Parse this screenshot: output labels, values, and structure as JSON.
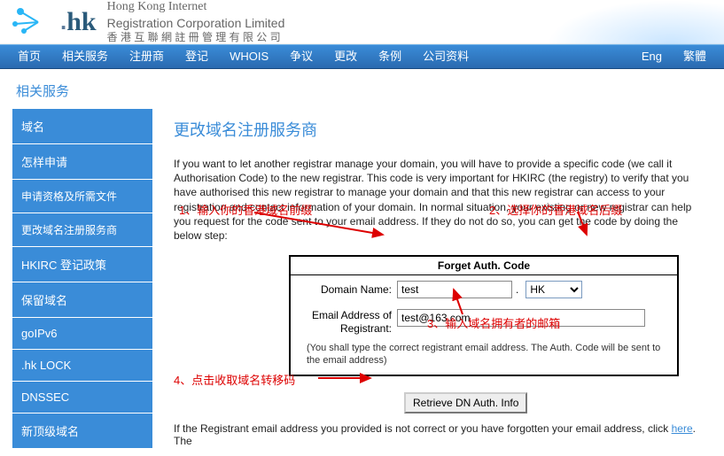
{
  "header": {
    "logo_dot": ".",
    "logo_hk": "hk",
    "en_name": "Hong Kong Internet",
    "en_name2": "Registration Corporation Limited",
    "cn_name": "香 港 互 聯 網 註 冊 管 理 有 限 公 司"
  },
  "topnav": {
    "items": [
      "首页",
      "相关服务",
      "注册商",
      "登记",
      "WHOIS",
      "争议",
      "更改",
      "条例",
      "公司资料"
    ],
    "lang": [
      "Eng",
      "繁體"
    ]
  },
  "section_title": "相关服务",
  "sidebar": {
    "items": [
      "域名",
      "怎样申请",
      "申请资格及所需文件",
      "更改域名注册服务商",
      "HKIRC 登记政策",
      "保留域名",
      "goIPv6",
      ".hk LOCK",
      "DNSSEC",
      "新顶级域名"
    ]
  },
  "main": {
    "heading": "更改域名注册服务商",
    "intro": "If you want to let another registrar manage your domain, you will have to provide a specific code (we call it Authorisation Code) to the new registrar. This code is very important for HKIRC (the registry) to verify that you have authorised this new registrar to manage your domain and that this new registrar can access to your registration and contact information of your domain. In normal situation, your existing or new registrar can help you request for the code sent to your email address. If they do not do so, you can get the code by doing the below step:",
    "form": {
      "title": "Forget Auth. Code",
      "domain_label": "Domain Name:",
      "domain_value": "test",
      "dot": ".",
      "suffix_value": "HK",
      "email_label": "Email Address of Registrant:",
      "email_value": "test@163.com",
      "note": "(You shall type the correct registrant email address. The Auth. Code will be sent to the email address)"
    },
    "retrieve_button": "Retrieve DN Auth. Info",
    "annotations": {
      "a1": "1、输入你的香港域名前缀",
      "a2": "2、选择你的香港域名后缀",
      "a3": "3、输入域名拥有者的邮箱",
      "a4": "4、点击收取域名转移码"
    },
    "footer": {
      "text_before": "If the Registrant email address you provided is not correct or you have forgotten your email address, click ",
      "link": "here",
      "text_after": ". The"
    }
  }
}
